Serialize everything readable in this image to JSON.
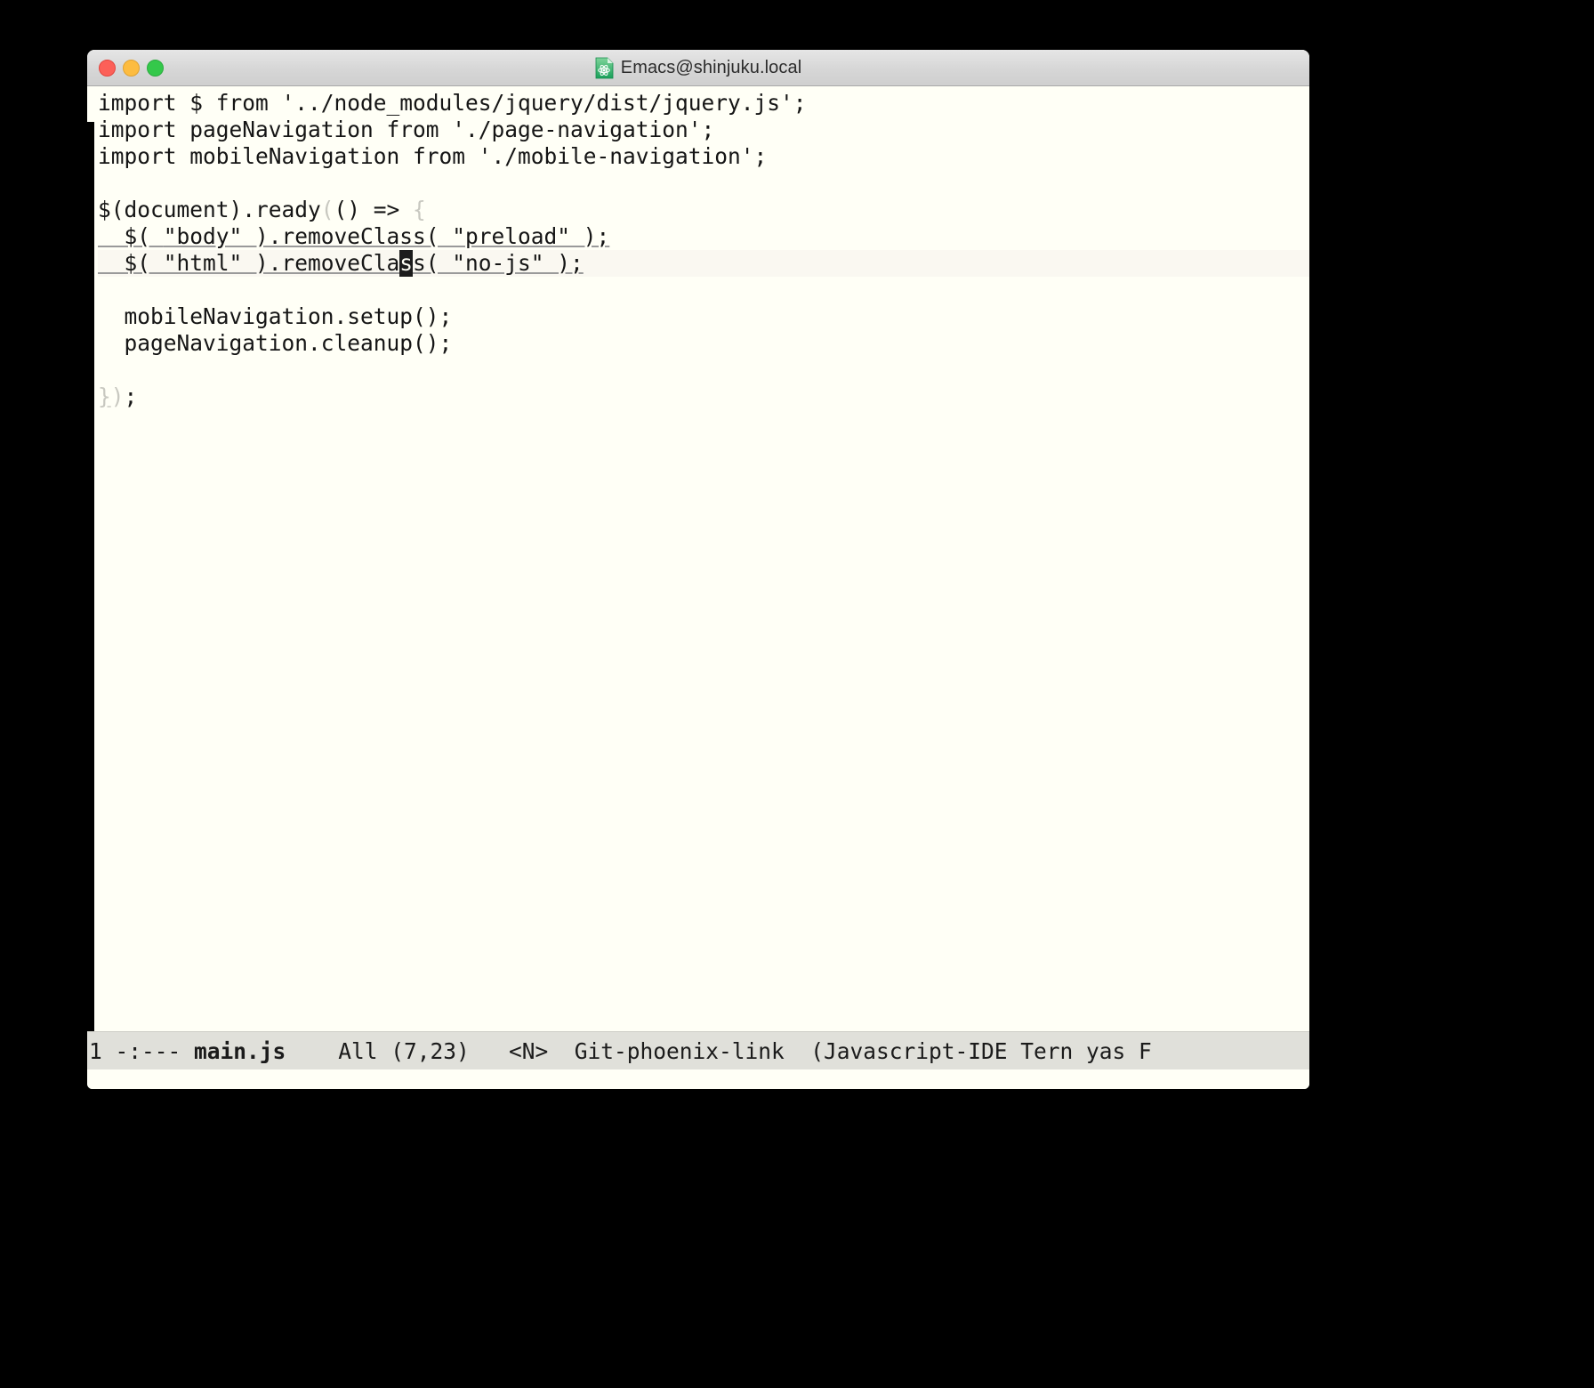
{
  "window": {
    "title": "Emacs@shinjuku.local",
    "icon": "emacs-document-icon",
    "traffic_lights": {
      "close_label": "Close",
      "minimize_label": "Minimize",
      "maximize_label": "Maximize",
      "close_color": "#fc6058",
      "minimize_color": "#fdbc40",
      "maximize_color": "#34c84a"
    }
  },
  "buffer": {
    "background": "#fffff6",
    "highlight_line_background": "#faf8f1",
    "cursor_color": "#1c1c1c",
    "lines": [
      {
        "n": 1,
        "seg": [
          {
            "t": "import $ from '../node_modules/jquery/dist/jquery.js';",
            "f": "plain"
          }
        ]
      },
      {
        "n": 2,
        "seg": [
          {
            "t": "import pageNavigation from './page-navigation';",
            "f": "plain"
          }
        ]
      },
      {
        "n": 3,
        "seg": [
          {
            "t": "import mobileNavigation from './mobile-navigation';",
            "f": "plain"
          }
        ]
      },
      {
        "n": 4,
        "seg": []
      },
      {
        "n": 5,
        "seg": [
          {
            "t": "$(document).ready",
            "f": "plain"
          },
          {
            "t": "(",
            "f": "dim"
          },
          {
            "t": "() => ",
            "f": "plain"
          },
          {
            "t": "{",
            "f": "dim"
          }
        ]
      },
      {
        "n": 6,
        "seg": [
          {
            "t": "  $( ",
            "f": "u"
          },
          {
            "t": "\"body\" ).removeClass( \"preload\" );",
            "f": "u"
          }
        ]
      },
      {
        "n": 7,
        "highlight": true,
        "seg": [
          {
            "t": "  $( \"html\" ).removeCla",
            "f": "u"
          },
          {
            "t": "s",
            "f": "cursor"
          },
          {
            "t": "s( \"no-js\" );",
            "f": "u"
          }
        ]
      },
      {
        "n": 8,
        "seg": []
      },
      {
        "n": 9,
        "seg": [
          {
            "t": "  mobileNavigation.setup();",
            "f": "plain"
          }
        ]
      },
      {
        "n": 10,
        "seg": [
          {
            "t": "  pageNavigation.cleanup();",
            "f": "plain"
          }
        ]
      },
      {
        "n": 11,
        "seg": []
      },
      {
        "n": 12,
        "seg": [
          {
            "t": "}",
            "f": "dim-u"
          },
          {
            "t": ")",
            "f": "dim"
          },
          {
            "t": ";",
            "f": "plain"
          }
        ]
      }
    ]
  },
  "modeline": {
    "background": "#e0e0da",
    "window_number": "1",
    "mod_flags": "-:---",
    "buffer_name": "main.js",
    "position": "All",
    "line_column": "(7,23)",
    "evil_state": "<N>",
    "vc_branch": "Git-phoenix-link",
    "major_minor_modes": "(Javascript-IDE Tern yas F",
    "full_text_left": "1 -:---",
    "text_after_name": "All (7,23)   <N>  Git-phoenix-link  (Javascript-IDE Tern yas F"
  }
}
